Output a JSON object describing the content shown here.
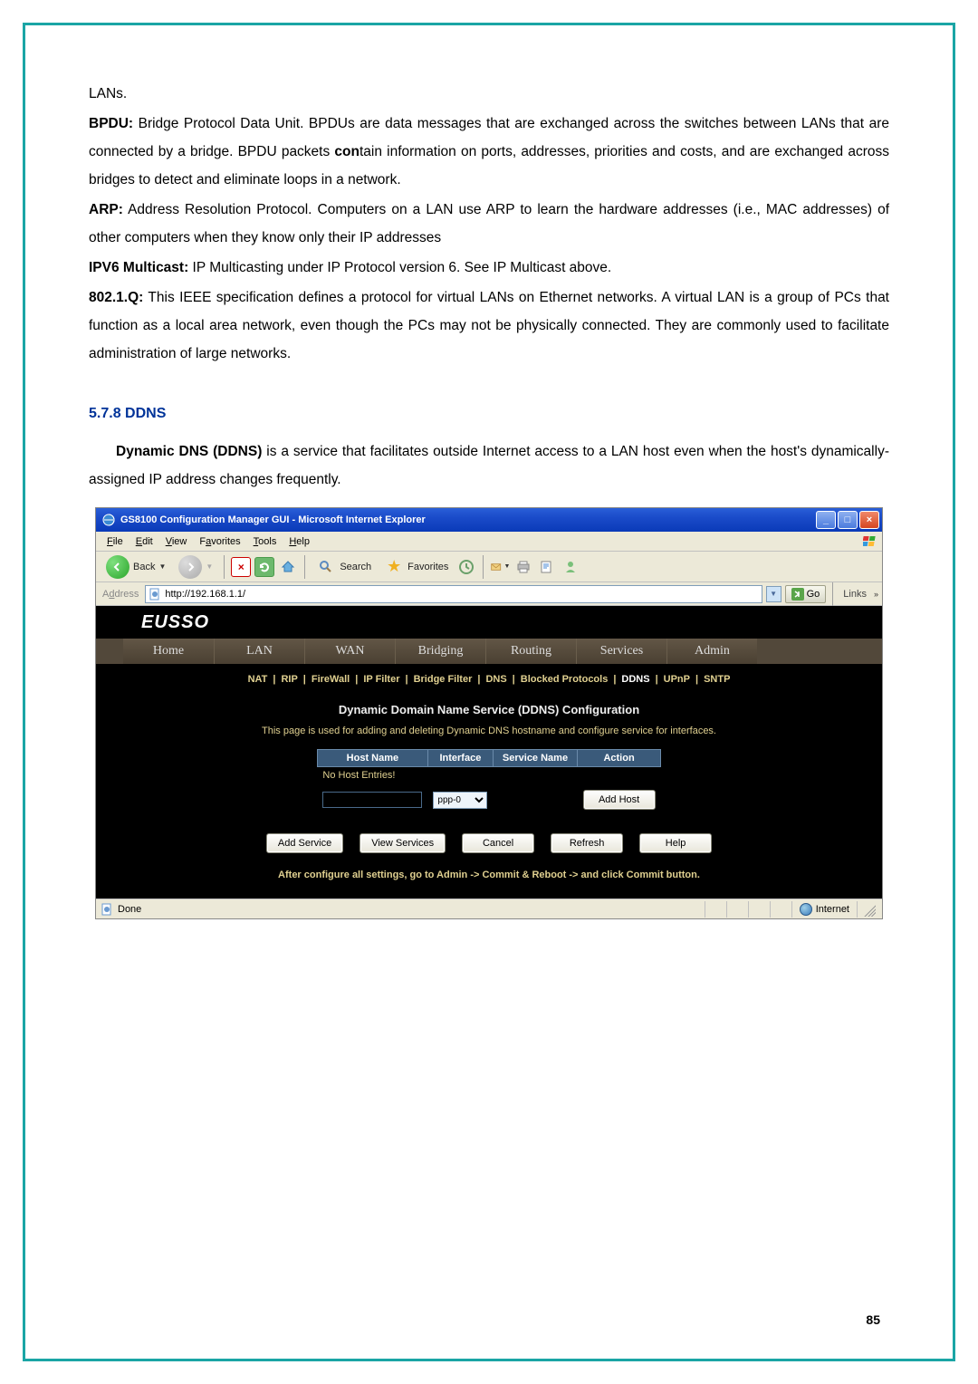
{
  "doc": {
    "lans": "LANs.",
    "bpdu_label": "BPDU:",
    "bpdu_text": " Bridge Protocol Data Unit. BPDUs are data messages that are exchanged across the switches between LANs that are connected by a bridge. BPDU packets ",
    "bpdu_bold": "con",
    "bpdu_text2": "tain information on ports, addresses, priorities and costs, and are exchanged across bridges to detect and eliminate loops in a network.",
    "arp_label": "ARP:",
    "arp_text": " Address Resolution Protocol. Computers on a LAN use ARP to learn the hardware addresses (i.e., MAC addresses) of other computers when they know only their IP addresses",
    "ipv6_label": "IPV6 Multicast:",
    "ipv6_text": " IP Multicasting under IP Protocol version 6. See IP Multicast above.",
    "q_label": "802.1.Q:",
    "q_text": " This IEEE specification defines a protocol for virtual LANs on Ethernet networks. A virtual LAN is a group of PCs that function as a local area network, even though the PCs may not be physically connected. They are commonly used to facilitate administration of large networks.",
    "section_578": "5.7.8    DDNS",
    "ddns_intro_bold": "Dynamic DNS (DDNS)",
    "ddns_intro_rest": " is a service that facilitates outside Internet access to a LAN host even when the host's dynamically-assigned IP address changes frequently.",
    "page_num": "85"
  },
  "ie": {
    "title": "GS8100 Configuration Manager GUI - Microsoft Internet Explorer",
    "menus": {
      "file": "File",
      "edit": "Edit",
      "view": "View",
      "favorites": "Favorites",
      "tools": "Tools",
      "help": "Help"
    },
    "toolbar": {
      "back": "Back",
      "search": "Search",
      "favorites": "Favorites"
    },
    "address_label": "Address",
    "url": "http://192.168.1.1/",
    "go": "Go",
    "links": "Links",
    "status_done": "Done",
    "status_zone": "Internet"
  },
  "page": {
    "logo": "EUSSO",
    "tabs": {
      "home": "Home",
      "lan": "LAN",
      "wan": "WAN",
      "bridging": "Bridging",
      "routing": "Routing",
      "services": "Services",
      "admin": "Admin"
    },
    "subtabs": [
      "NAT",
      "RIP",
      "FireWall",
      "IP Filter",
      "Bridge Filter",
      "DNS",
      "Blocked Protocols",
      "DDNS",
      "UPnP",
      "SNTP"
    ],
    "active_sub": "DDNS",
    "heading": "Dynamic Domain Name Service (DDNS) Configuration",
    "desc": "This page is used for adding and deleting Dynamic DNS hostname and configure service for interfaces.",
    "thead": {
      "hostname": "Host Name",
      "interface": "Interface",
      "service": "Service Name",
      "action": "Action"
    },
    "no_entries": "No Host Entries!",
    "iface_opt": "ppp-0",
    "add_host": "Add Host",
    "buttons": {
      "add_service": "Add Service",
      "view_services": "View Services",
      "cancel": "Cancel",
      "refresh": "Refresh",
      "help": "Help"
    },
    "commit": "After configure all settings, go to Admin -> Commit & Reboot -> and click Commit button."
  }
}
